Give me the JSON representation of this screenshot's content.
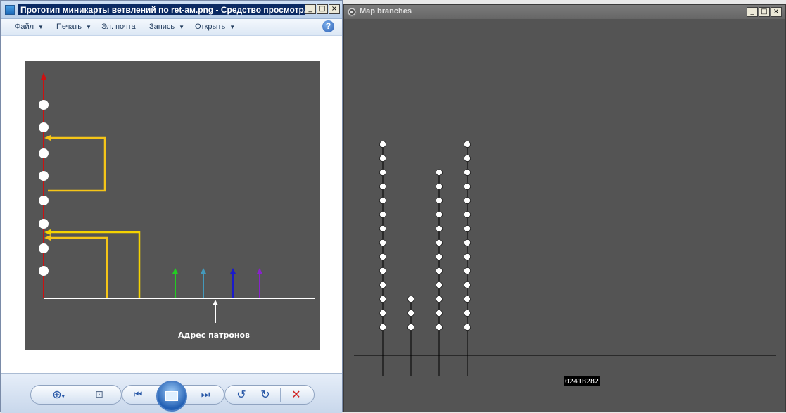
{
  "viewer": {
    "title": "Прототип миникарты ветвлений по ret-ам.png - Средство просмотр...",
    "window_buttons": [
      "_",
      "□",
      "×"
    ],
    "menu": [
      {
        "label": "Файл",
        "has_arrow": true
      },
      {
        "label": "Печать",
        "has_arrow": true
      },
      {
        "label": "Эл. почта",
        "has_arrow": false
      },
      {
        "label": "Запись",
        "has_arrow": true
      },
      {
        "label": "Открыть",
        "has_arrow": true
      }
    ],
    "help_label": "?",
    "diagram": {
      "caption": "Адрес патронов",
      "colors": {
        "background": "#555555",
        "main_axis": "#cc1111",
        "base_line": "#ffffff",
        "ret_a": "#f5c518",
        "ret_b": "#f5d300",
        "green": "#22cc22",
        "teal": "#4499bb",
        "blue": "#1a1acc",
        "purple": "#8822cc",
        "node": "#ffffff"
      },
      "node_count": 8
    },
    "toolbar": {
      "zoom_icon": "zoom-icon",
      "fit_icon": "fit-to-window-icon",
      "prev_icon": "previous-icon",
      "slideshow_icon": "slideshow-icon",
      "next_icon": "next-icon",
      "rotate_ccw_icon": "rotate-ccw-icon",
      "rotate_cw_icon": "rotate-cw-icon",
      "delete_icon": "delete-icon"
    }
  },
  "mapwin": {
    "title": "Map branches",
    "window_buttons": [
      "_",
      "□",
      "×"
    ],
    "address_label": "0241B282",
    "columns": [
      {
        "nodes": 14
      },
      {
        "nodes": 3
      },
      {
        "nodes": 12
      },
      {
        "nodes": 14
      }
    ],
    "colors": {
      "background": "#545454",
      "line": "#000000",
      "node": "#ffffff"
    }
  }
}
